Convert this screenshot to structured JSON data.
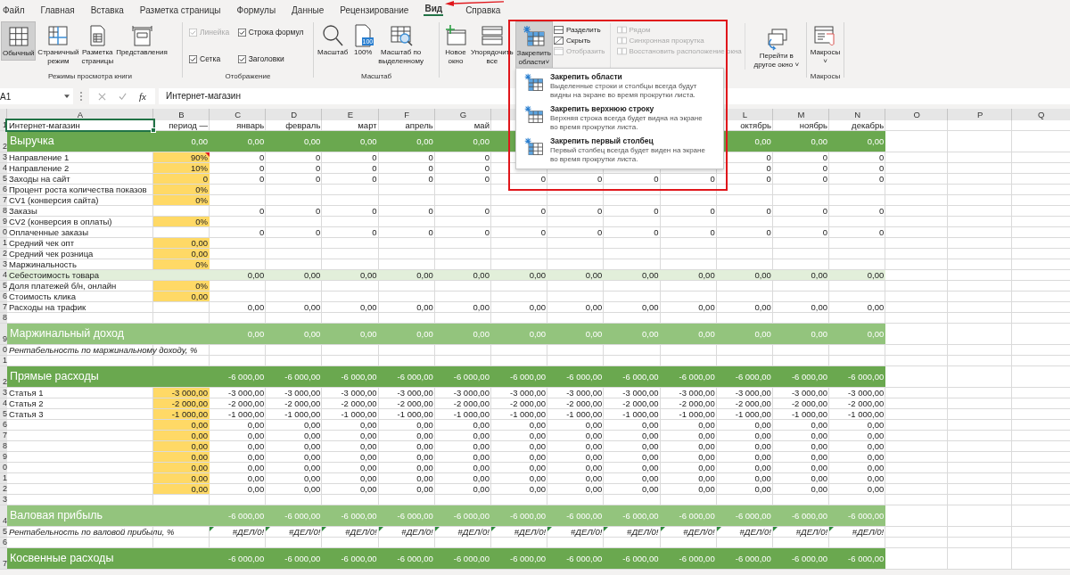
{
  "ribbon_tabs": [
    {
      "label": "Файл",
      "selected": false
    },
    {
      "label": "Главная",
      "selected": false
    },
    {
      "label": "Вставка",
      "selected": false
    },
    {
      "label": "Разметка страницы",
      "selected": false
    },
    {
      "label": "Формулы",
      "selected": false
    },
    {
      "label": "Данные",
      "selected": false
    },
    {
      "label": "Рецензирование",
      "selected": false
    },
    {
      "label": "Вид",
      "selected": true
    },
    {
      "label": "Справка",
      "selected": false
    }
  ],
  "ribbon": {
    "views": {
      "label": "Режимы просмотра книги",
      "buttons": [
        {
          "kind": "normal",
          "label": "Обычный",
          "selected": true
        },
        {
          "kind": "pagebreak",
          "label": "Страничный режим",
          "selected": false
        },
        {
          "kind": "layout",
          "label": "Разметка страницы",
          "selected": false
        },
        {
          "kind": "views",
          "label": "Представления",
          "selected": false
        }
      ]
    },
    "show": {
      "label": "Отображение",
      "checks": [
        {
          "label": "Линейка",
          "checked": true,
          "disabled": true
        },
        {
          "label": "Строка формул",
          "checked": true,
          "disabled": false
        },
        {
          "label": "Сетка",
          "checked": true,
          "disabled": false
        },
        {
          "label": "Заголовки",
          "checked": true,
          "disabled": false
        }
      ]
    },
    "zoom": {
      "label": "Масштаб",
      "buttons": [
        {
          "kind": "zoom",
          "label": "Масштаб"
        },
        {
          "kind": "hundred",
          "label": "100%",
          "badge": "100"
        },
        {
          "kind": "selection",
          "label": "Масштаб по выделенному"
        }
      ]
    },
    "window": {
      "buttons": [
        {
          "kind": "newwin",
          "label": "Новое окно",
          "selected": false
        },
        {
          "kind": "arrange",
          "label": "Упорядочить все",
          "selected": false
        },
        {
          "kind": "freeze",
          "label": "Закрепить области",
          "selected": true,
          "caret": "˅"
        }
      ],
      "small": [
        {
          "kind": "split",
          "label": "Разделить",
          "disabled": false
        },
        {
          "kind": "hide",
          "label": "Скрыть",
          "disabled": false
        },
        {
          "kind": "unhide",
          "label": "Отобразить",
          "disabled": true
        },
        {
          "kind": "side",
          "label": "Рядом",
          "disabled": true
        },
        {
          "kind": "sync",
          "label": "Синхронная прокрутка",
          "disabled": true
        },
        {
          "kind": "reset",
          "label": "Восстановить расположение окна",
          "disabled": true
        }
      ],
      "switch": {
        "label": "Перейти в другое окно",
        "caret": "˅"
      }
    },
    "macros": {
      "label": "Макросы",
      "button": "Макросы",
      "caret": "˅"
    }
  },
  "formula_bar": {
    "name_box": "A1",
    "fx": "fx",
    "value": "Интернет-магазин"
  },
  "freeze_menu": [
    {
      "kind": "all",
      "title": "Закрепить области",
      "description": "Выделенные строки и столбцы всегда будут видны на экране во время прокрутки листа."
    },
    {
      "kind": "row",
      "title": "Закрепить верхнюю строку",
      "description": "Верхняя строка всегда будет видна на экране во время прокрутки листа."
    },
    {
      "kind": "col",
      "title": "Закрепить первый столбец",
      "description": "Первый столбец всегда будет виден на экране во время прокрутки листа."
    }
  ],
  "sheet": {
    "columns": [
      "A",
      "B",
      "C",
      "D",
      "E",
      "F",
      "G",
      null,
      null,
      null,
      null,
      "L",
      "M",
      "N",
      "O",
      "P",
      "Q"
    ],
    "rows": [
      {
        "label": "1",
        "kind": "data",
        "input": false,
        "selected": true,
        "cells": [
          "Интернет-магазин",
          "период —",
          "январь",
          "февраль",
          "март",
          "апрель",
          "май",
          null,
          null,
          null,
          null,
          "октябрь",
          "ноябрь",
          "декабрь"
        ]
      },
      {
        "label": "2",
        "kind": "band",
        "input": false,
        "selected": false,
        "cells": [
          "Выручка",
          "0,00",
          "0,00",
          "0,00",
          "0,00",
          "0,00",
          "0,00",
          null,
          null,
          null,
          null,
          "0,00",
          "0,00",
          "0,00"
        ]
      },
      {
        "label": "3",
        "kind": "data",
        "input": true,
        "selected": false,
        "comment": true,
        "cells": [
          "Направление 1",
          "90%",
          "0",
          "0",
          "0",
          "0",
          "0",
          null,
          null,
          null,
          null,
          "0",
          "0",
          "0"
        ]
      },
      {
        "label": "4",
        "kind": "data",
        "input": true,
        "selected": false,
        "cells": [
          "Направление 2",
          "10%",
          "0",
          "0",
          "0",
          "0",
          "0",
          null,
          null,
          null,
          null,
          "0",
          "0",
          "0"
        ]
      },
      {
        "label": "5",
        "kind": "data",
        "input": true,
        "selected": false,
        "cells": [
          "Заходы на сайт",
          "0",
          "0",
          "0",
          "0",
          "0",
          "0",
          "0",
          "0",
          "0",
          "0",
          "0",
          "0",
          "0"
        ]
      },
      {
        "label": "6",
        "kind": "data",
        "input": true,
        "selected": false,
        "cells": [
          "Процент роста количества показов",
          "0%",
          null,
          null,
          null,
          null,
          null,
          null,
          null,
          null,
          null,
          null,
          null,
          null
        ]
      },
      {
        "label": "7",
        "kind": "data",
        "input": true,
        "selected": false,
        "cells": [
          "CV1 (конверсия сайта)",
          "0%",
          null,
          null,
          null,
          null,
          null,
          null,
          null,
          null,
          null,
          null,
          null,
          null
        ]
      },
      {
        "label": "8",
        "kind": "data",
        "input": false,
        "selected": false,
        "cells": [
          "Заказы",
          null,
          "0",
          "0",
          "0",
          "0",
          "0",
          "0",
          "0",
          "0",
          "0",
          "0",
          "0",
          "0"
        ]
      },
      {
        "label": "9",
        "kind": "data",
        "input": true,
        "selected": false,
        "cells": [
          "CV2 (конверсия в оплаты)",
          "0%",
          null,
          null,
          null,
          null,
          null,
          null,
          null,
          null,
          null,
          null,
          null,
          null
        ]
      },
      {
        "label": "0",
        "kind": "data",
        "input": false,
        "selected": false,
        "cells": [
          "Оплаченные заказы",
          null,
          "0",
          "0",
          "0",
          "0",
          "0",
          "0",
          "0",
          "0",
          "0",
          "0",
          "0",
          "0"
        ]
      },
      {
        "label": "1",
        "kind": "data",
        "input": true,
        "selected": false,
        "cells": [
          "Средний чек опт",
          "0,00",
          null,
          null,
          null,
          null,
          null,
          null,
          null,
          null,
          null,
          null,
          null,
          null
        ]
      },
      {
        "label": "2",
        "kind": "data",
        "input": true,
        "selected": false,
        "cells": [
          "Средний чек розница",
          "0,00",
          null,
          null,
          null,
          null,
          null,
          null,
          null,
          null,
          null,
          null,
          null,
          null
        ]
      },
      {
        "label": "3",
        "kind": "data",
        "input": true,
        "selected": false,
        "cells": [
          "Маржинальность",
          "0%",
          null,
          null,
          null,
          null,
          null,
          null,
          null,
          null,
          null,
          null,
          null,
          null
        ]
      },
      {
        "label": "4",
        "kind": "light",
        "input": false,
        "selected": false,
        "cells": [
          "Себестоимость товара",
          null,
          "0,00",
          "0,00",
          "0,00",
          "0,00",
          "0,00",
          "0,00",
          "0,00",
          "0,00",
          "0,00",
          "0,00",
          "0,00",
          "0,00"
        ]
      },
      {
        "label": "5",
        "kind": "data",
        "input": true,
        "selected": false,
        "cells": [
          "Доля платежей б/н, онлайн",
          "0%",
          null,
          null,
          null,
          null,
          null,
          null,
          null,
          null,
          null,
          null,
          null,
          null
        ]
      },
      {
        "label": "6",
        "kind": "data",
        "input": true,
        "selected": false,
        "cells": [
          "Стоимость клика",
          "0,00",
          null,
          null,
          null,
          null,
          null,
          null,
          null,
          null,
          null,
          null,
          null,
          null
        ]
      },
      {
        "label": "7",
        "kind": "data",
        "input": false,
        "selected": false,
        "cells": [
          "Расходы на трафик",
          null,
          "0,00",
          "0,00",
          "0,00",
          "0,00",
          "0,00",
          "0,00",
          "0,00",
          "0,00",
          "0,00",
          "0,00",
          "0,00",
          "0,00"
        ]
      },
      {
        "label": "8",
        "kind": "data",
        "input": false,
        "selected": false,
        "cells": [
          null,
          null,
          null,
          null,
          null,
          null,
          null,
          null,
          null,
          null,
          null,
          null,
          null,
          null
        ]
      },
      {
        "label": "9",
        "kind": "band-light",
        "input": false,
        "selected": false,
        "cells": [
          "Маржинальный доход",
          null,
          "0,00",
          "0,00",
          "0,00",
          "0,00",
          "0,00",
          "0,00",
          "0,00",
          "0,00",
          "0,00",
          "0,00",
          "0,00",
          "0,00"
        ]
      },
      {
        "label": "0",
        "kind": "italic",
        "input": false,
        "selected": false,
        "cells": [
          "Рентабельность по маржинальному доходу, %",
          null,
          null,
          null,
          null,
          null,
          null,
          null,
          null,
          null,
          null,
          null,
          null,
          null
        ]
      },
      {
        "label": "1",
        "kind": "data",
        "input": false,
        "selected": false,
        "cells": [
          null,
          null,
          null,
          null,
          null,
          null,
          null,
          null,
          null,
          null,
          null,
          null,
          null,
          null
        ]
      },
      {
        "label": "2",
        "kind": "band",
        "input": false,
        "selected": false,
        "cells": [
          "Прямые расходы",
          null,
          "-6 000,00",
          "-6 000,00",
          "-6 000,00",
          "-6 000,00",
          "-6 000,00",
          "-6 000,00",
          "-6 000,00",
          "-6 000,00",
          "-6 000,00",
          "-6 000,00",
          "-6 000,00",
          "-6 000,00"
        ]
      },
      {
        "label": "3",
        "kind": "data",
        "input": true,
        "selected": false,
        "cells": [
          "Статья 1",
          "-3 000,00",
          "-3 000,00",
          "-3 000,00",
          "-3 000,00",
          "-3 000,00",
          "-3 000,00",
          "-3 000,00",
          "-3 000,00",
          "-3 000,00",
          "-3 000,00",
          "-3 000,00",
          "-3 000,00",
          "-3 000,00"
        ]
      },
      {
        "label": "4",
        "kind": "data",
        "input": true,
        "selected": false,
        "cells": [
          "Статья 2",
          "-2 000,00",
          "-2 000,00",
          "-2 000,00",
          "-2 000,00",
          "-2 000,00",
          "-2 000,00",
          "-2 000,00",
          "-2 000,00",
          "-2 000,00",
          "-2 000,00",
          "-2 000,00",
          "-2 000,00",
          "-2 000,00"
        ]
      },
      {
        "label": "5",
        "kind": "data",
        "input": true,
        "selected": false,
        "cells": [
          "Статья 3",
          "-1 000,00",
          "-1 000,00",
          "-1 000,00",
          "-1 000,00",
          "-1 000,00",
          "-1 000,00",
          "-1 000,00",
          "-1 000,00",
          "-1 000,00",
          "-1 000,00",
          "-1 000,00",
          "-1 000,00",
          "-1 000,00"
        ]
      },
      {
        "label": "6",
        "kind": "data",
        "input": true,
        "selected": false,
        "cells": [
          null,
          "0,00",
          "0,00",
          "0,00",
          "0,00",
          "0,00",
          "0,00",
          "0,00",
          "0,00",
          "0,00",
          "0,00",
          "0,00",
          "0,00",
          "0,00"
        ]
      },
      {
        "label": "7",
        "kind": "data",
        "input": true,
        "selected": false,
        "cells": [
          null,
          "0,00",
          "0,00",
          "0,00",
          "0,00",
          "0,00",
          "0,00",
          "0,00",
          "0,00",
          "0,00",
          "0,00",
          "0,00",
          "0,00",
          "0,00"
        ]
      },
      {
        "label": "8",
        "kind": "data",
        "input": true,
        "selected": false,
        "cells": [
          null,
          "0,00",
          "0,00",
          "0,00",
          "0,00",
          "0,00",
          "0,00",
          "0,00",
          "0,00",
          "0,00",
          "0,00",
          "0,00",
          "0,00",
          "0,00"
        ]
      },
      {
        "label": "9",
        "kind": "data",
        "input": true,
        "selected": false,
        "cells": [
          null,
          "0,00",
          "0,00",
          "0,00",
          "0,00",
          "0,00",
          "0,00",
          "0,00",
          "0,00",
          "0,00",
          "0,00",
          "0,00",
          "0,00",
          "0,00"
        ]
      },
      {
        "label": "0",
        "kind": "data",
        "input": true,
        "selected": false,
        "cells": [
          null,
          "0,00",
          "0,00",
          "0,00",
          "0,00",
          "0,00",
          "0,00",
          "0,00",
          "0,00",
          "0,00",
          "0,00",
          "0,00",
          "0,00",
          "0,00"
        ]
      },
      {
        "label": "1",
        "kind": "data",
        "input": true,
        "selected": false,
        "cells": [
          null,
          "0,00",
          "0,00",
          "0,00",
          "0,00",
          "0,00",
          "0,00",
          "0,00",
          "0,00",
          "0,00",
          "0,00",
          "0,00",
          "0,00",
          "0,00"
        ]
      },
      {
        "label": "2",
        "kind": "data",
        "input": true,
        "selected": false,
        "cells": [
          null,
          "0,00",
          "0,00",
          "0,00",
          "0,00",
          "0,00",
          "0,00",
          "0,00",
          "0,00",
          "0,00",
          "0,00",
          "0,00",
          "0,00",
          "0,00"
        ]
      },
      {
        "label": "3",
        "kind": "data",
        "input": false,
        "selected": false,
        "cells": [
          null,
          null,
          null,
          null,
          null,
          null,
          null,
          null,
          null,
          null,
          null,
          null,
          null,
          null
        ]
      },
      {
        "label": "4",
        "kind": "band-light",
        "input": false,
        "selected": false,
        "cells": [
          "Валовая прибыль",
          null,
          "-6 000,00",
          "-6 000,00",
          "-6 000,00",
          "-6 000,00",
          "-6 000,00",
          "-6 000,00",
          "-6 000,00",
          "-6 000,00",
          "-6 000,00",
          "-6 000,00",
          "-6 000,00",
          "-6 000,00"
        ]
      },
      {
        "label": "5",
        "kind": "italic",
        "input": false,
        "selected": false,
        "flagged": true,
        "cells": [
          "Рентабельность по валовой прибыли, %",
          null,
          "#ДЕЛ/0!",
          "#ДЕЛ/0!",
          "#ДЕЛ/0!",
          "#ДЕЛ/0!",
          "#ДЕЛ/0!",
          "#ДЕЛ/0!",
          "#ДЕЛ/0!",
          "#ДЕЛ/0!",
          "#ДЕЛ/0!",
          "#ДЕЛ/0!",
          "#ДЕЛ/0!",
          "#ДЕЛ/0!"
        ]
      },
      {
        "label": "6",
        "kind": "data",
        "input": false,
        "selected": false,
        "cells": [
          null,
          null,
          null,
          null,
          null,
          null,
          null,
          null,
          null,
          null,
          null,
          null,
          null,
          null
        ]
      },
      {
        "label": "7",
        "kind": "band",
        "input": false,
        "selected": false,
        "cells": [
          "Косвенные расходы",
          null,
          "-6 000,00",
          "-6 000,00",
          "-6 000,00",
          "-6 000,00",
          "-6 000,00",
          "-6 000,00",
          "-6 000,00",
          "-6 000,00",
          "-6 000,00",
          "-6 000,00",
          "-6 000,00",
          "-6 000,00"
        ]
      }
    ]
  }
}
